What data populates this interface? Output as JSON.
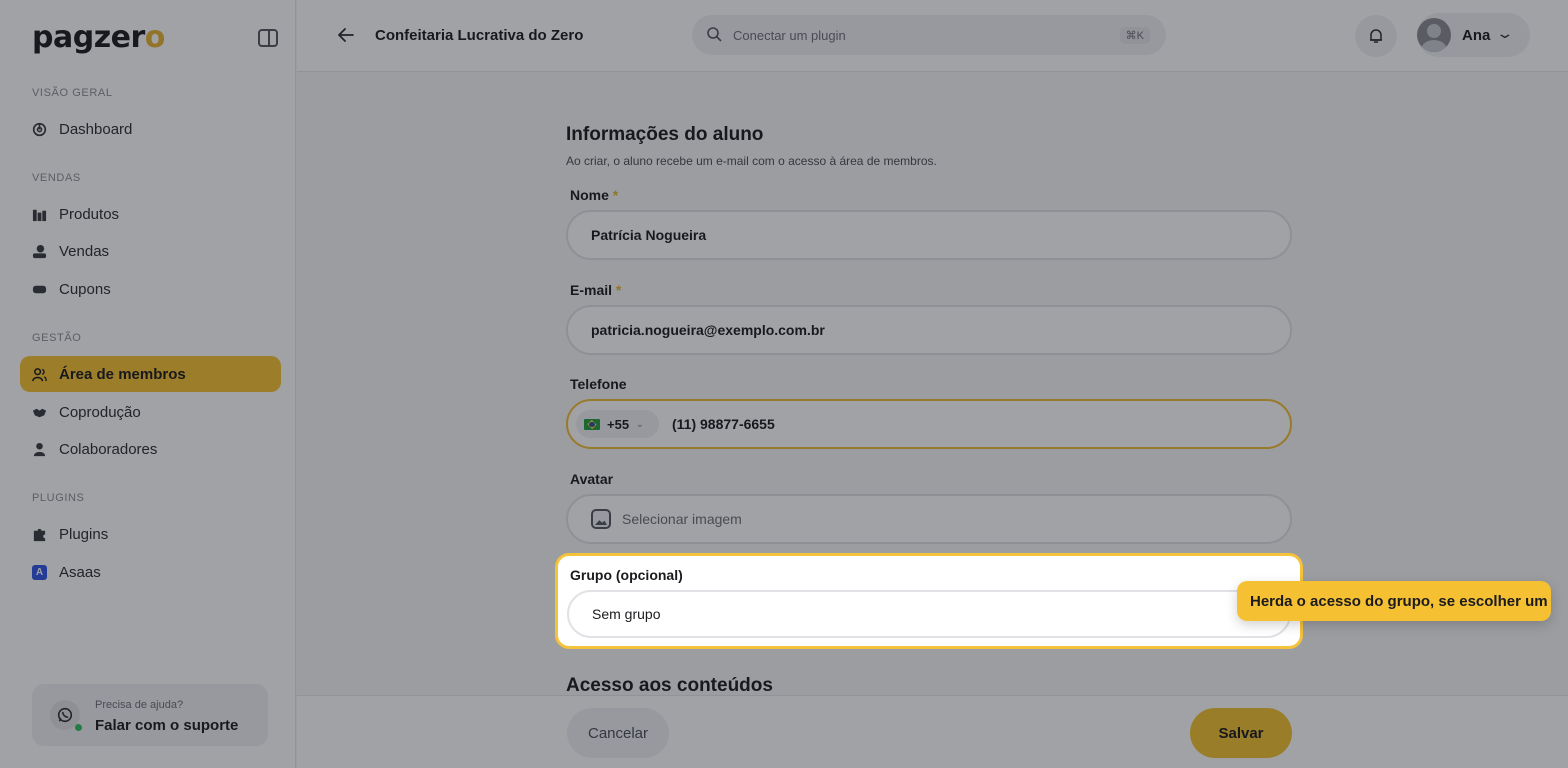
{
  "brand": {
    "logo_main": "pagzer",
    "logo_accent": "o",
    "accent_color": "#f5c133"
  },
  "sidebar": {
    "sections": [
      {
        "label": "VISÃO GERAL",
        "items": [
          {
            "label": "Dashboard",
            "icon": "dashboard-icon"
          }
        ]
      },
      {
        "label": "VENDAS",
        "items": [
          {
            "label": "Produtos",
            "icon": "products-icon"
          },
          {
            "label": "Vendas",
            "icon": "sales-icon"
          },
          {
            "label": "Cupons",
            "icon": "coupon-icon"
          }
        ]
      },
      {
        "label": "GESTÃO",
        "items": [
          {
            "label": "Área de membros",
            "icon": "users-icon",
            "active": true
          },
          {
            "label": "Coprodução",
            "icon": "handshake-icon"
          },
          {
            "label": "Colaboradores",
            "icon": "person-icon"
          }
        ]
      },
      {
        "label": "PLUGINS",
        "items": [
          {
            "label": "Plugins",
            "icon": "puzzle-icon"
          },
          {
            "label": "Asaas",
            "icon": "asaas-icon",
            "icon_text": "A"
          }
        ]
      }
    ],
    "support": {
      "question": "Precisa de ajuda?",
      "action": "Falar com o suporte"
    }
  },
  "header": {
    "title": "Confeitaria Lucrativa do Zero",
    "search_placeholder": "Conectar um plugin",
    "search_shortcut": "⌘K",
    "user_name": "Ana"
  },
  "form": {
    "title": "Informações do aluno",
    "subtitle": "Ao criar, o aluno recebe um e-mail com o acesso à área de membros.",
    "required_mark": "*",
    "name": {
      "label": "Nome",
      "value": "Patrícia Nogueira"
    },
    "email": {
      "label": "E-mail",
      "value": "patricia.nogueira@exemplo.com.br"
    },
    "phone": {
      "label": "Telefone",
      "country_code": "+55",
      "value": "(11) 98877-6655"
    },
    "avatar": {
      "label": "Avatar",
      "placeholder": "Selecionar imagem"
    },
    "group": {
      "label": "Grupo (opcional)",
      "value": "Sem grupo"
    },
    "access_title": "Acesso aos conteúdos"
  },
  "tooltip": {
    "text": "Herda o acesso do grupo, se escolher um"
  },
  "footer": {
    "cancel_label": "Cancelar",
    "save_label": "Salvar"
  }
}
